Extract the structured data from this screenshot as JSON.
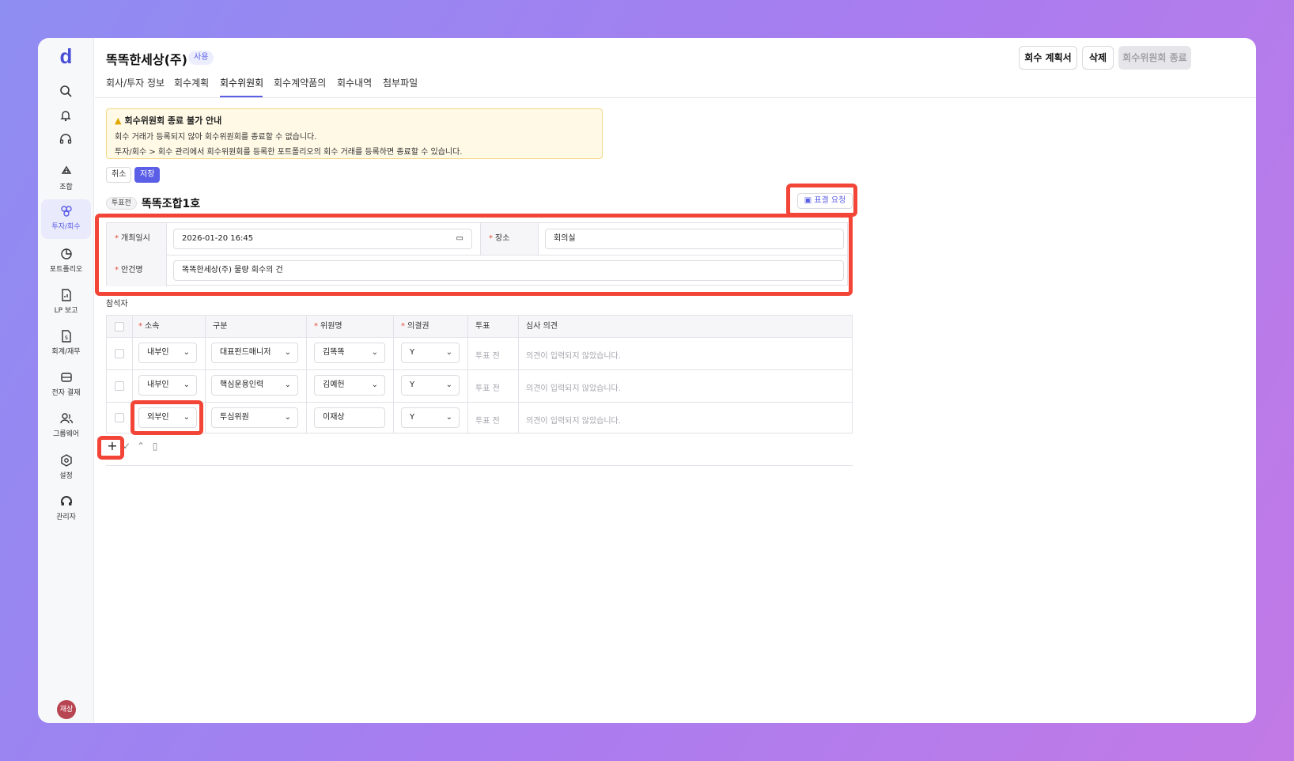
{
  "app": {
    "logo": "d"
  },
  "sidebar": {
    "items": [
      {
        "label": "조합",
        "icon": "recycle-icon"
      },
      {
        "label": "투자/회수",
        "icon": "investment-icon",
        "active": true
      },
      {
        "label": "포트폴리오",
        "icon": "pie-chart-icon"
      },
      {
        "label": "LP 보고",
        "icon": "report-icon"
      },
      {
        "label": "회계/재무",
        "icon": "finance-icon"
      },
      {
        "label": "전자 결재",
        "icon": "mail-icon"
      },
      {
        "label": "그룹웨어",
        "icon": "users-icon"
      },
      {
        "label": "설정",
        "icon": "gear-icon"
      },
      {
        "label": "관리자",
        "icon": "admin-icon"
      }
    ],
    "avatar": "재상"
  },
  "header": {
    "title": "똑똑한세상(주)",
    "badge": "사용",
    "buttons": {
      "plan": "회수 계획서",
      "delete": "삭제",
      "end": "회수위원회 종료"
    }
  },
  "tabs": [
    "회사/투자 정보",
    "회수계획",
    "회수위원회",
    "회수계약품의",
    "회수내역",
    "첨부파일"
  ],
  "notice": {
    "title": "회수위원회 종료 불가 안내",
    "line1": "회수 거래가 등록되지 않아 회수위원회를 종료할 수 없습니다.",
    "line2": "투자/회수 > 회수 관리에서 회수위원회를 등록한 포트폴리오의 회수 거래를 등록하면 종료할 수 있습니다."
  },
  "actions": {
    "cancel": "취소",
    "save": "저장"
  },
  "fund": {
    "status": "투표전",
    "name": "똑똑조합1호",
    "vote_request": "표결 요청"
  },
  "form": {
    "date_label": "개최일시",
    "date_value": "2026-01-20 16:45",
    "place_label": "장소",
    "place_value": "회의실",
    "agenda_label": "안건명",
    "agenda_value": "똑똑한세상(주) 물량 회수의 건"
  },
  "participants": {
    "section_label": "참석자",
    "headers": {
      "affiliation": "소속",
      "type": "구분",
      "member": "위원명",
      "voting": "의결권",
      "vote": "투표",
      "opinion": "심사 의견"
    },
    "rows": [
      {
        "affiliation": "내부인",
        "type": "대표펀드매니저",
        "member": "김똑똑",
        "voting": "Y",
        "vote": "투표 전",
        "opinion": "의견이 입력되지 않았습니다."
      },
      {
        "affiliation": "내부인",
        "type": "핵심운용인력",
        "member": "김예헌",
        "voting": "Y",
        "vote": "투표 전",
        "opinion": "의견이 입력되지 않았습니다."
      },
      {
        "affiliation": "외부인",
        "type": "투심위원",
        "member": "이재상",
        "voting": "Y",
        "vote": "투표 전",
        "opinion": "의견이 입력되지 않았습니다."
      }
    ]
  },
  "colors": {
    "accent": "#5b5ee6",
    "highlight": "#f24437",
    "warning_bg": "#fff9e6"
  }
}
